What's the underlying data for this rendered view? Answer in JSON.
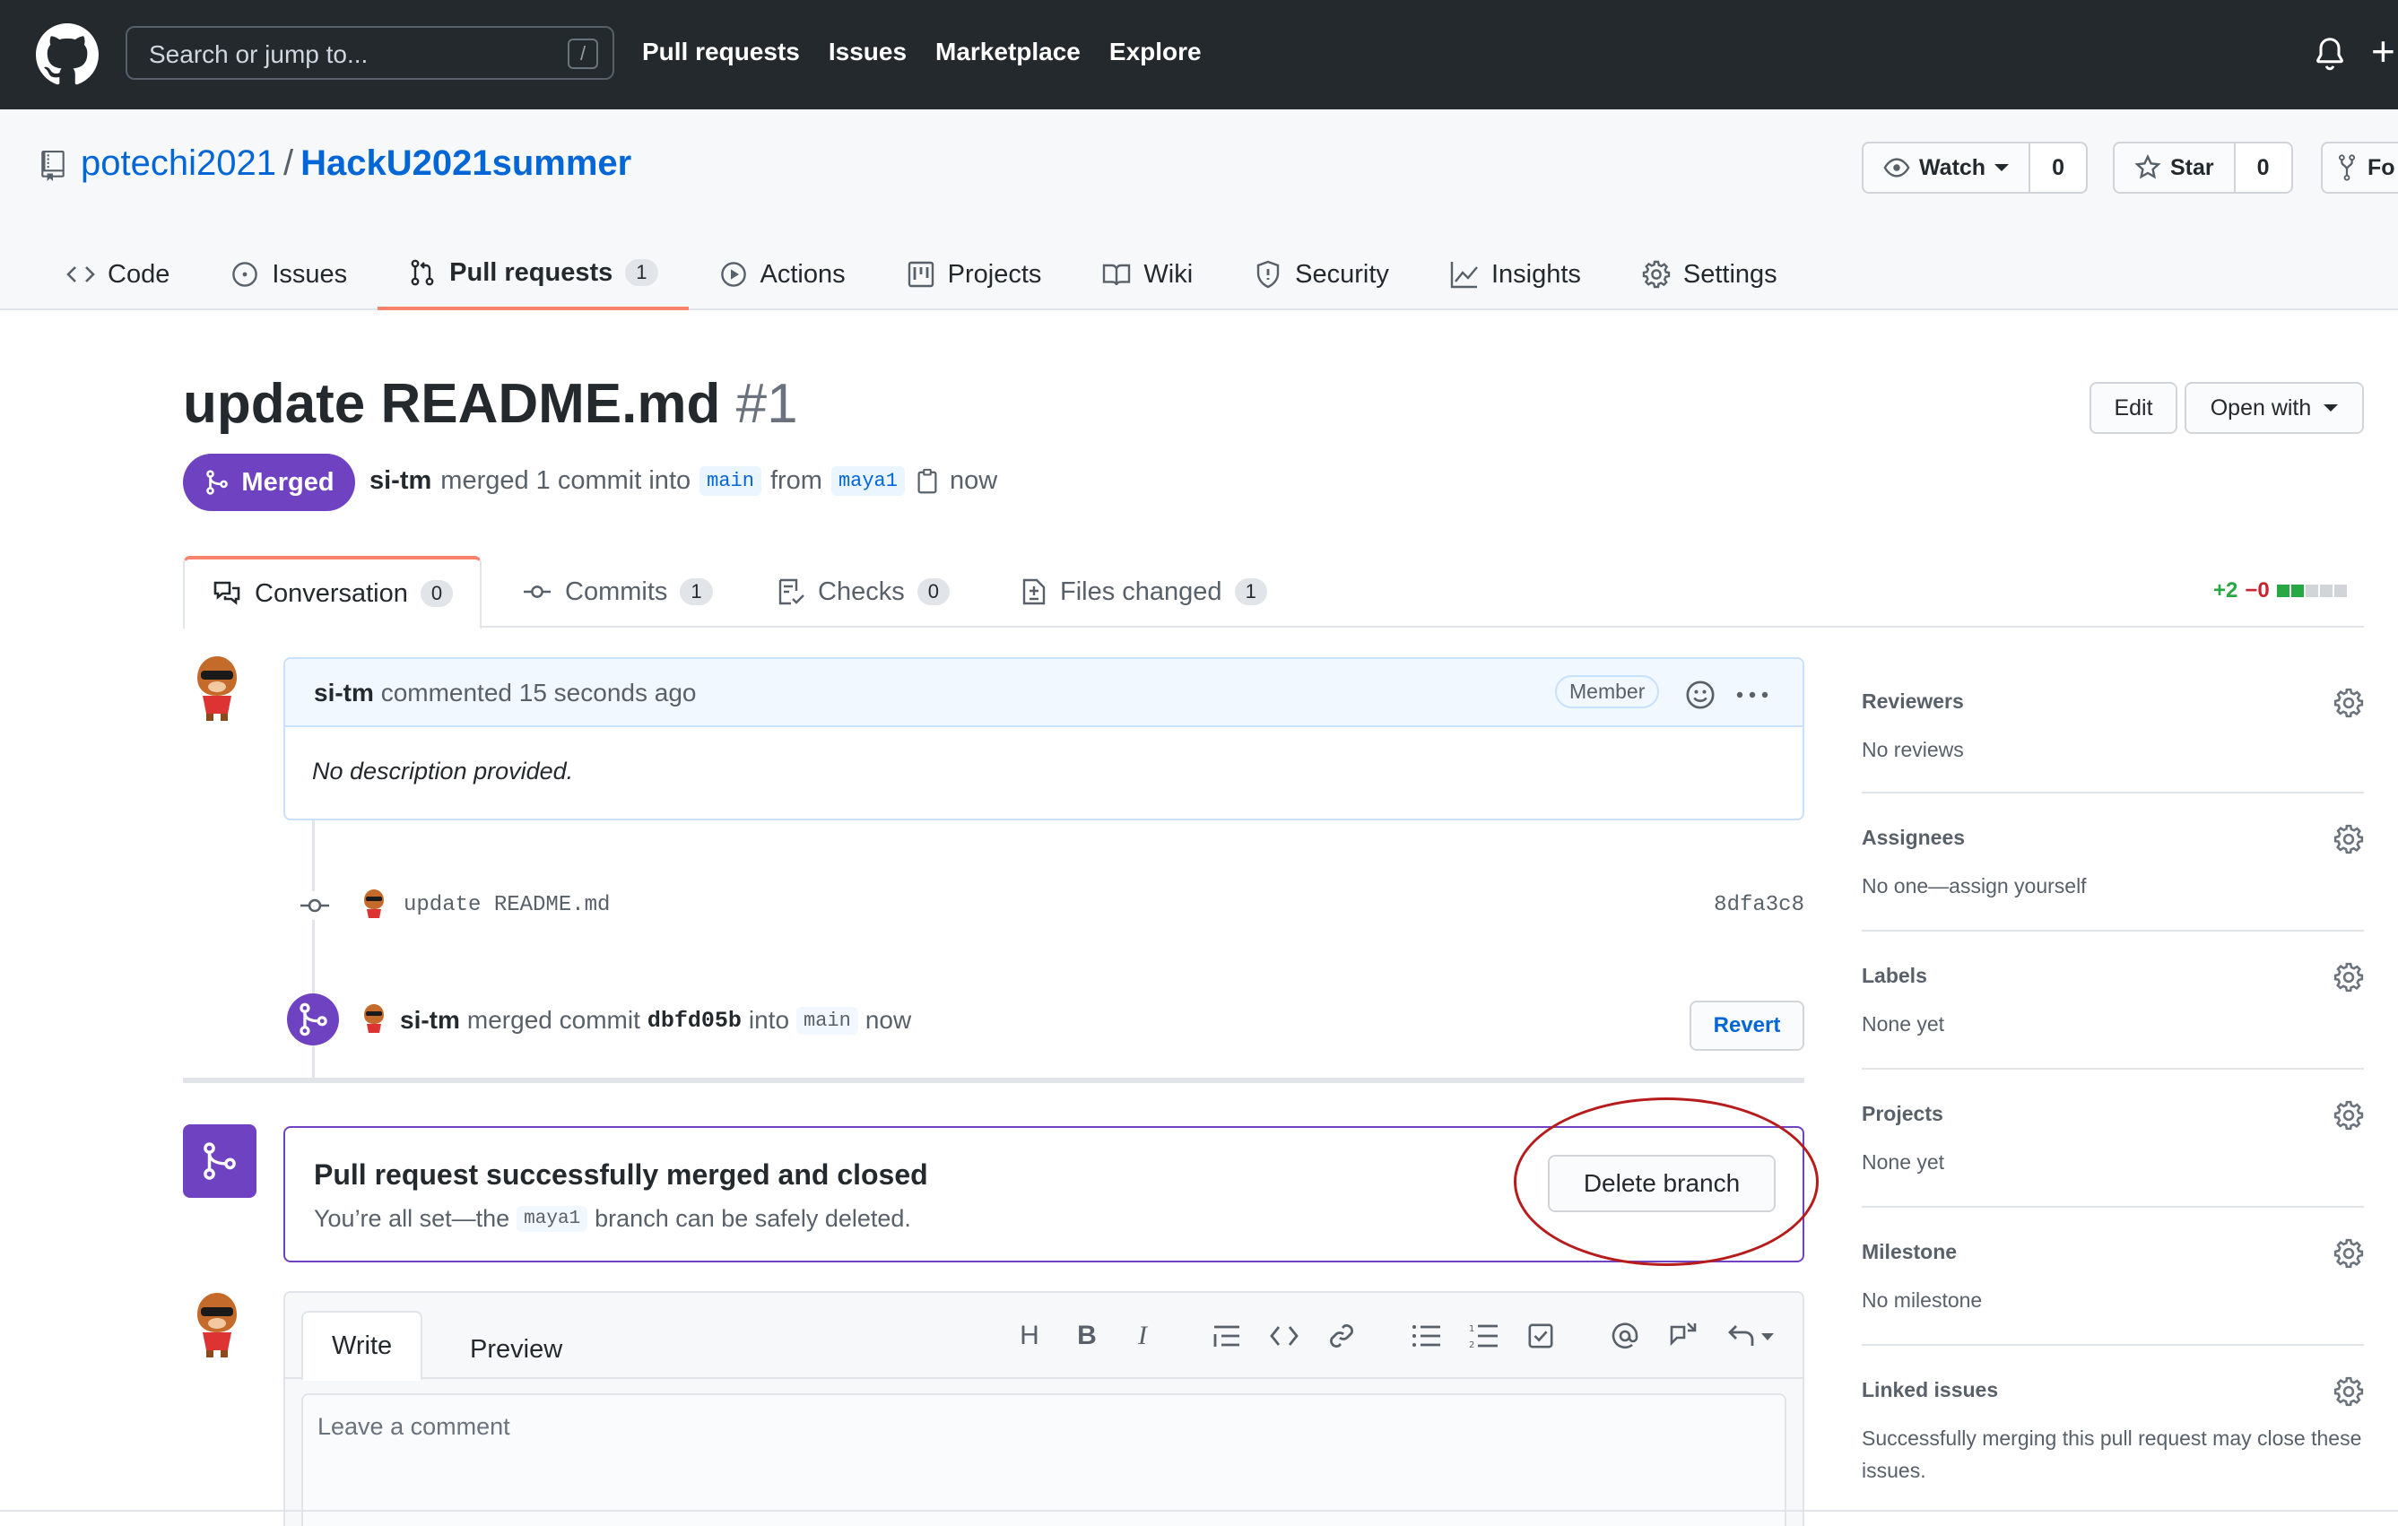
{
  "header": {
    "search_placeholder": "Search or jump to...",
    "search_shortcut": "/",
    "nav": [
      "Pull requests",
      "Issues",
      "Marketplace",
      "Explore"
    ]
  },
  "repo": {
    "owner": "potechi2021",
    "separator": "/",
    "name": "HackU2021summer",
    "watch_label": "Watch",
    "watch_count": "0",
    "star_label": "Star",
    "star_count": "0",
    "fork_label": "Fo",
    "tabs": [
      {
        "label": "Code",
        "icon": "code-icon"
      },
      {
        "label": "Issues",
        "icon": "issue-icon"
      },
      {
        "label": "Pull requests",
        "icon": "pull-request-icon",
        "badge": "1"
      },
      {
        "label": "Actions",
        "icon": "play-icon"
      },
      {
        "label": "Projects",
        "icon": "project-icon"
      },
      {
        "label": "Wiki",
        "icon": "book-icon"
      },
      {
        "label": "Security",
        "icon": "shield-icon"
      },
      {
        "label": "Insights",
        "icon": "graph-icon"
      },
      {
        "label": "Settings",
        "icon": "gear-icon"
      }
    ]
  },
  "pr": {
    "title": "update README.md",
    "number": "#1",
    "edit_label": "Edit",
    "open_with_label": "Open with",
    "state": "Merged",
    "author": "si-tm",
    "merged_text": "merged 1 commit into",
    "base": "main",
    "from_text": "from",
    "head": "maya1",
    "time": "now",
    "tabs": [
      {
        "label": "Conversation",
        "count": "0",
        "icon": "comment-discussion-icon"
      },
      {
        "label": "Commits",
        "count": "1",
        "icon": "commit-icon"
      },
      {
        "label": "Checks",
        "count": "0",
        "icon": "checklist-icon"
      },
      {
        "label": "Files changed",
        "count": "1",
        "icon": "file-diff-icon"
      }
    ],
    "additions": "+2",
    "deletions": "−0"
  },
  "comment": {
    "author": "si-tm",
    "action": "commented 15 seconds ago",
    "badge": "Member",
    "body": "No description provided."
  },
  "commit": {
    "message": "update README.md",
    "sha": "8dfa3c8"
  },
  "merge_event": {
    "author": "si-tm",
    "text": "merged commit",
    "sha": "dbfd05b",
    "into": "into",
    "base": "main",
    "time": "now",
    "revert_label": "Revert"
  },
  "merged_box": {
    "title": "Pull request successfully merged and closed",
    "text_before": "You’re all set—the",
    "branch": "maya1",
    "text_after": "branch can be safely deleted.",
    "delete_label": "Delete branch"
  },
  "editor": {
    "write_label": "Write",
    "preview_label": "Preview",
    "placeholder": "Leave a comment"
  },
  "sidebar": [
    {
      "title": "Reviewers",
      "value": "No reviews"
    },
    {
      "title": "Assignees",
      "value": "No one—assign yourself"
    },
    {
      "title": "Labels",
      "value": "None yet"
    },
    {
      "title": "Projects",
      "value": "None yet"
    },
    {
      "title": "Milestone",
      "value": "No milestone"
    },
    {
      "title": "Linked issues",
      "value": "Successfully merging this pull request may close these issues."
    }
  ],
  "colors": {
    "header_bg": "#24292e",
    "link": "#0366d6",
    "merged": "#6f42c1",
    "accent_tab": "#f9826c",
    "additions": "#28a745",
    "deletions": "#cb2431"
  }
}
